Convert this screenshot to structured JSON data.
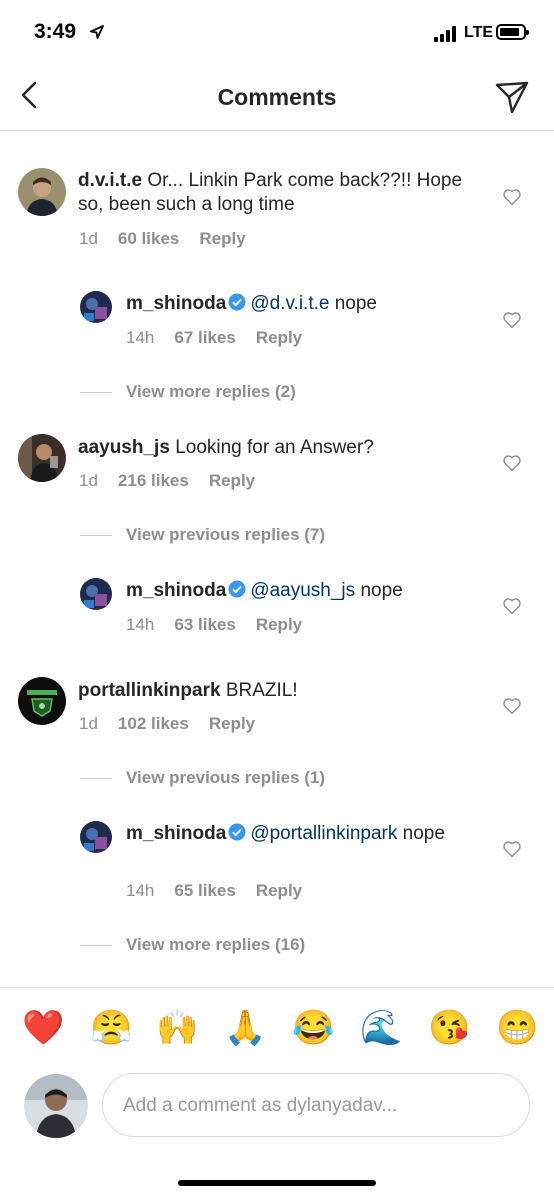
{
  "status": {
    "time": "3:49",
    "network": "LTE"
  },
  "nav": {
    "title": "Comments"
  },
  "comments": [
    {
      "username": "d.v.i.t.e",
      "text": "Or... Linkin Park come back??!! Hope so, been such a long time",
      "age": "1d",
      "likes": "60 likes",
      "reply": "Reply"
    },
    {
      "username": "aayush_js",
      "text": "Looking for an Answer?",
      "age": "1d",
      "likes": "216 likes",
      "reply": "Reply"
    },
    {
      "username": "portallinkinpark",
      "text": "BRAZIL!",
      "age": "1d",
      "likes": "102 likes",
      "reply": "Reply"
    }
  ],
  "replies": [
    {
      "username": "m_shinoda",
      "mention": "@d.v.i.t.e",
      "text": "nope",
      "age": "14h",
      "likes": "67 likes",
      "reply": "Reply"
    },
    {
      "username": "m_shinoda",
      "mention": "@aayush_js",
      "text": "nope",
      "age": "14h",
      "likes": "63 likes",
      "reply": "Reply"
    },
    {
      "username": "m_shinoda",
      "mention": "@portallinkinpark",
      "text": "nope",
      "age": "14h",
      "likes": "65 likes",
      "reply": "Reply"
    }
  ],
  "view_links": [
    "View more replies (2)",
    "View previous replies (7)",
    "View previous replies (1)",
    "View more replies (16)"
  ],
  "emoji_bar": [
    "❤️",
    "😤",
    "🙌",
    "🙏",
    "😂",
    "🌊",
    "😘",
    "😁"
  ],
  "composer": {
    "placeholder": "Add a comment as dylanyadav..."
  },
  "colors": {
    "mention": "#003569",
    "meta": "#8e8e8e",
    "verified": "#3897f0",
    "border": "#dbdbdb"
  }
}
